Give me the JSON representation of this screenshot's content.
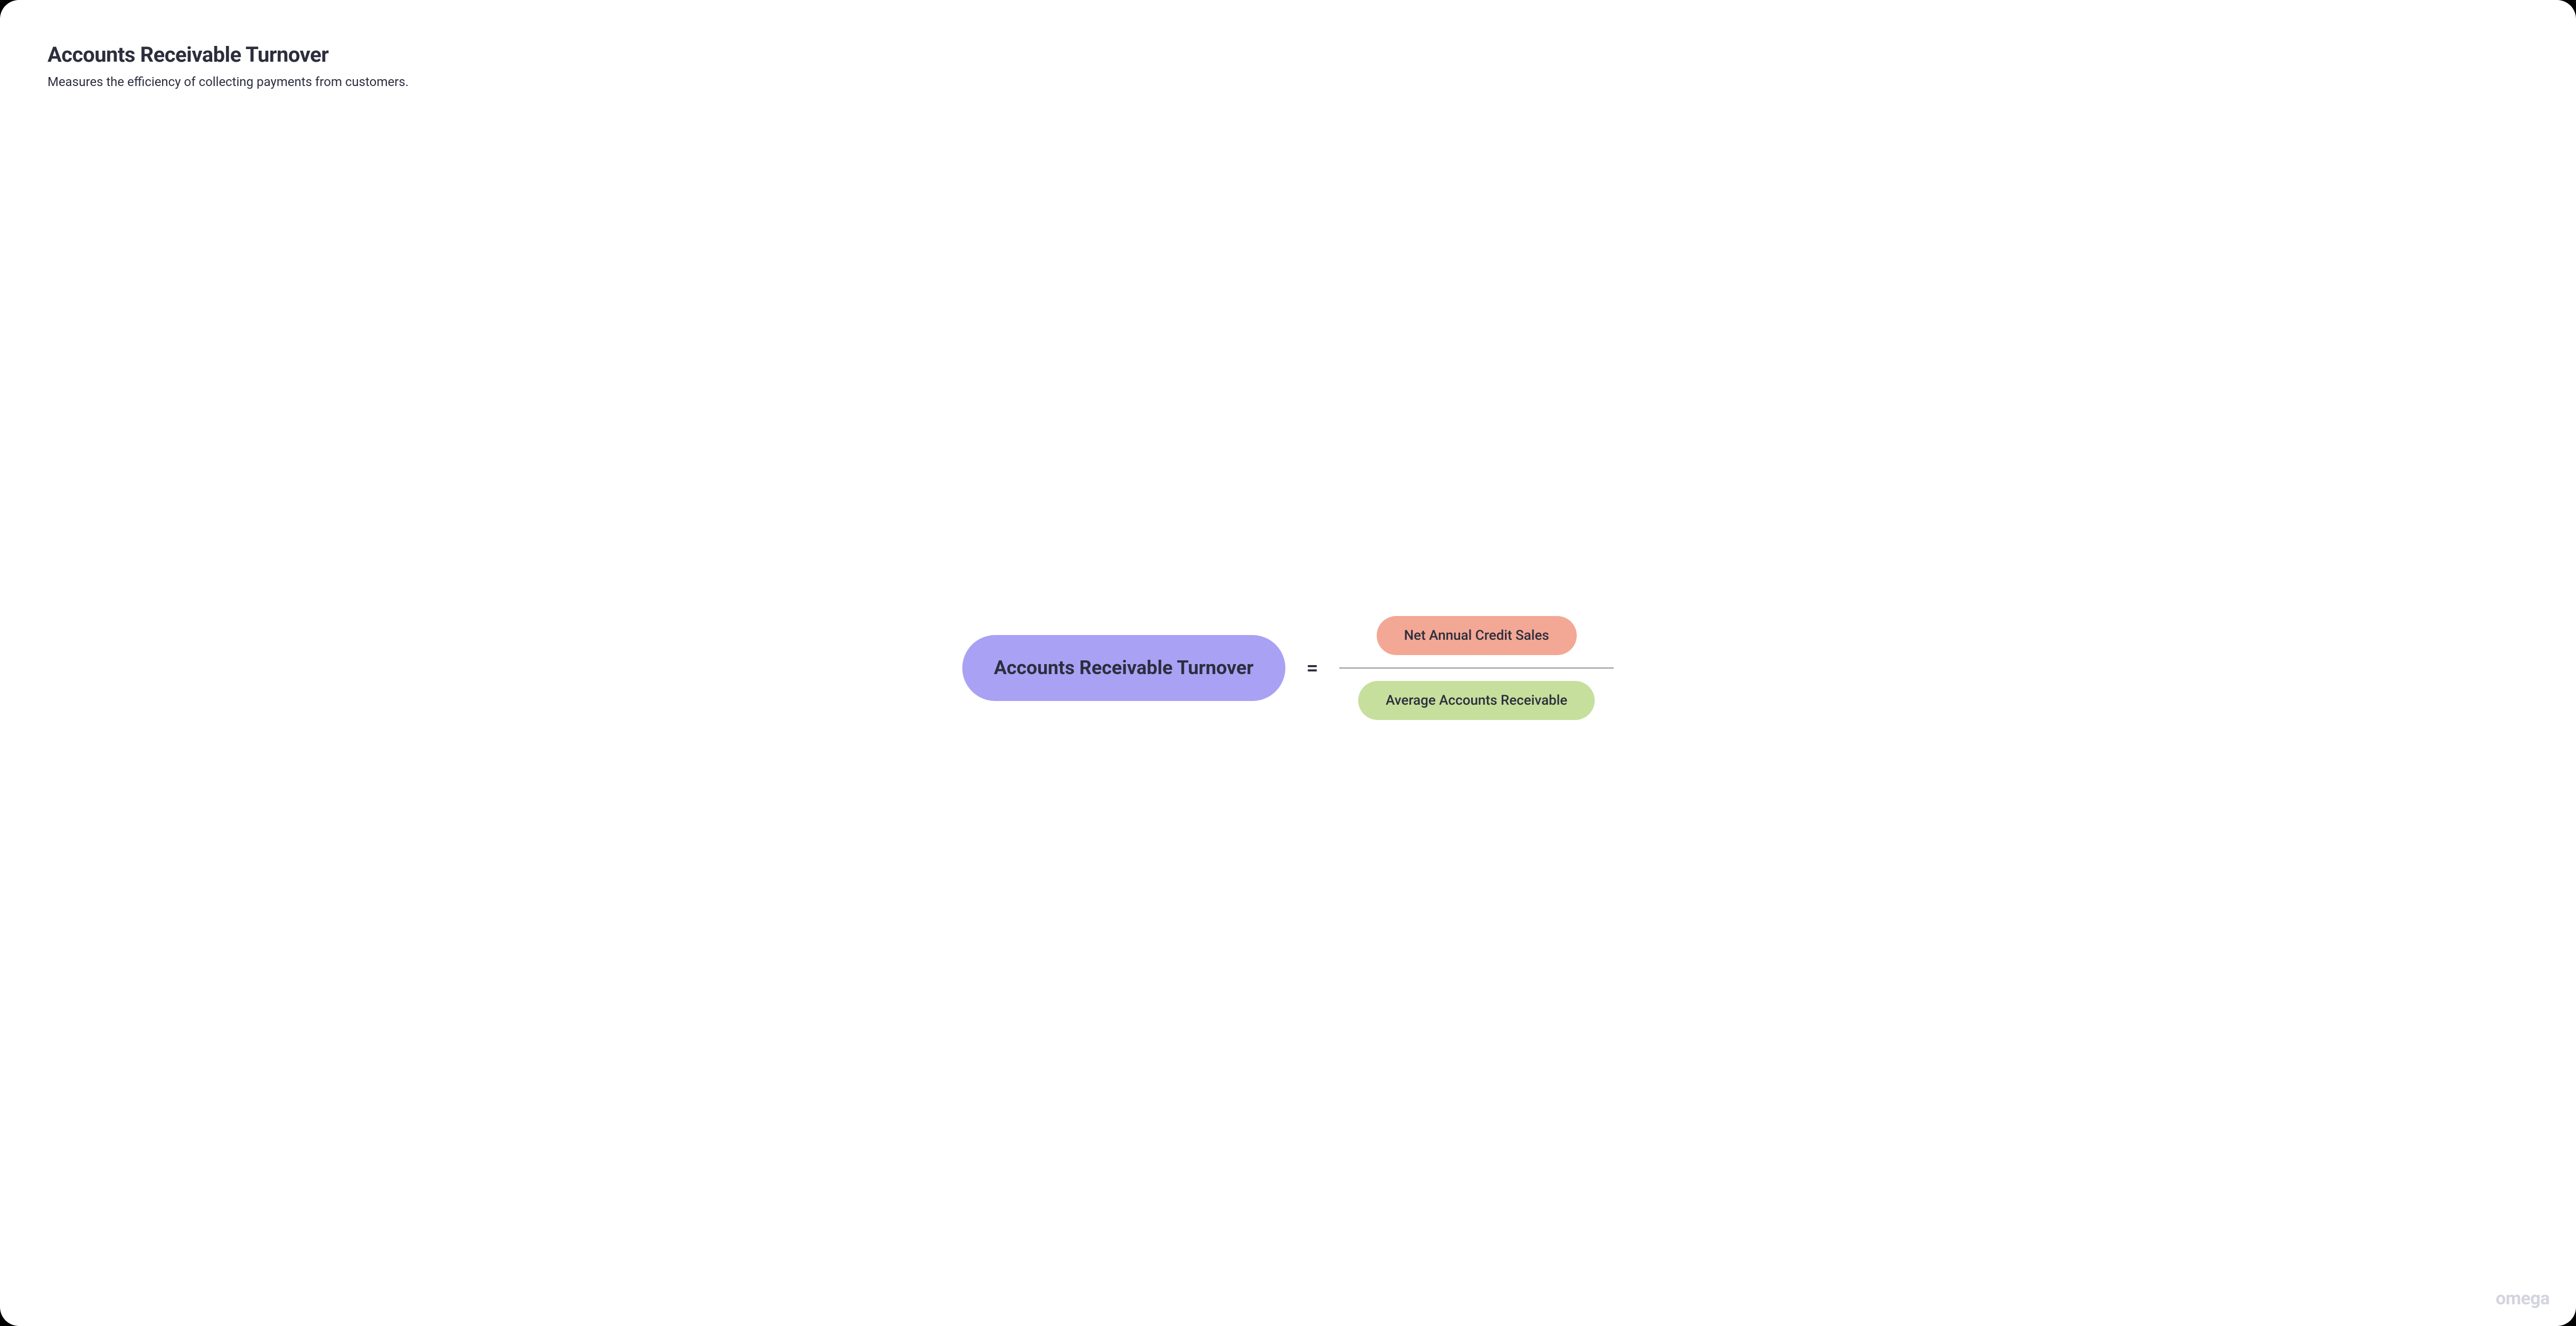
{
  "header": {
    "title": "Accounts Receivable Turnover",
    "subtitle": "Measures the efficiency of collecting payments from customers."
  },
  "formula": {
    "result_label": "Accounts Receivable Turnover",
    "equals": "=",
    "numerator_label": "Net Annual Credit Sales",
    "denominator_label": "Average Accounts Receivable"
  },
  "brand": "omega",
  "colors": {
    "result_pill": "#a9a1f4",
    "numerator_pill": "#f3a795",
    "denominator_pill": "#c6df9c",
    "text": "#2c2e3d",
    "brand_text": "#d3d4de"
  }
}
